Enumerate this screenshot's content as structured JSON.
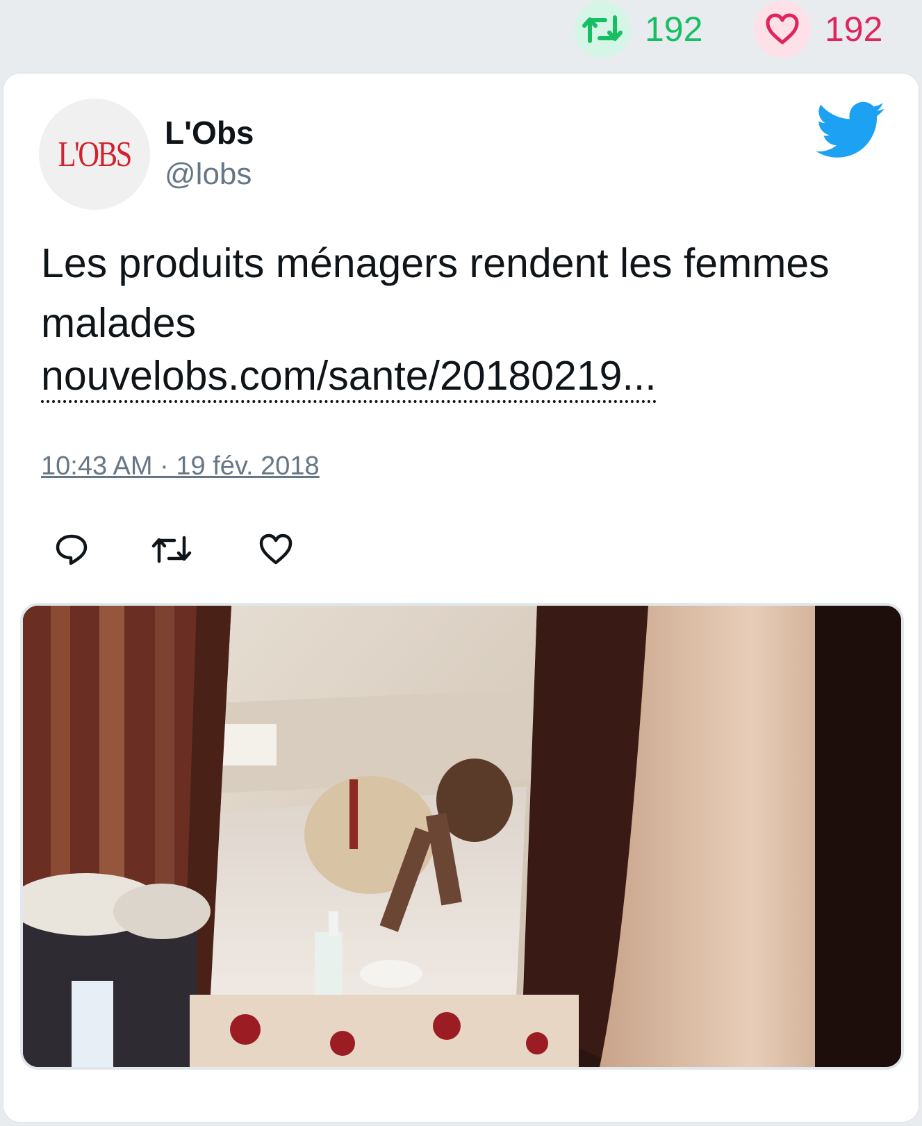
{
  "stats": {
    "retweets": "192",
    "likes": "192"
  },
  "author": {
    "name": "L'Obs",
    "handle": "@lobs",
    "avatar_text": "L'OBS"
  },
  "tweet": {
    "text": "Les produits ménagers rendent les femmes malades",
    "link": "nouvelobs.com/sante/20180219...",
    "timestamp": "10:43 AM · 19 fév. 2018"
  },
  "icons": {
    "retweet": "retweet-icon",
    "like": "heart-icon",
    "reply": "reply-icon",
    "brand": "twitter-bird-icon"
  },
  "colors": {
    "retweet": "#17bf63",
    "like": "#e0245e",
    "handle": "#657786",
    "twitter_blue": "#1da1f2"
  }
}
